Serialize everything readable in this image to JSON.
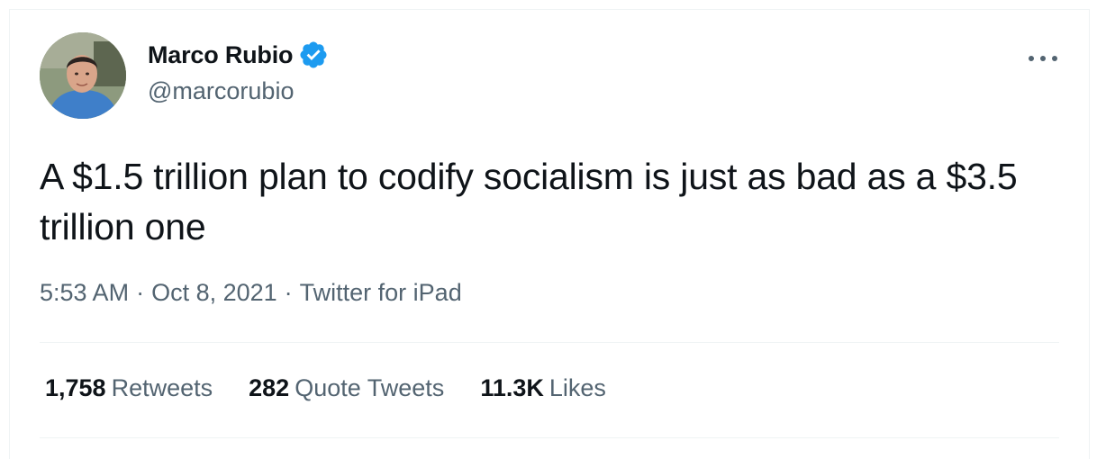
{
  "author": {
    "display_name": "Marco Rubio",
    "handle": "@marcorubio",
    "verified": true
  },
  "tweet": {
    "text": "A $1.5 trillion plan to codify socialism is just as bad as a $3.5 trillion one"
  },
  "meta": {
    "time": "5:53 AM",
    "separator1": "·",
    "date": "Oct 8, 2021",
    "separator2": "·",
    "source": "Twitter for iPad"
  },
  "stats": {
    "retweets_count": "1,758",
    "retweets_label": "Retweets",
    "quotes_count": "282",
    "quotes_label": "Quote Tweets",
    "likes_count": "11.3K",
    "likes_label": "Likes"
  },
  "colors": {
    "text_primary": "#0f1419",
    "text_secondary": "#536471",
    "verified_blue": "#1d9bf0",
    "divider": "#eff3f4"
  },
  "icons": {
    "verified": "verified-badge-icon",
    "more": "more-dots-icon"
  }
}
